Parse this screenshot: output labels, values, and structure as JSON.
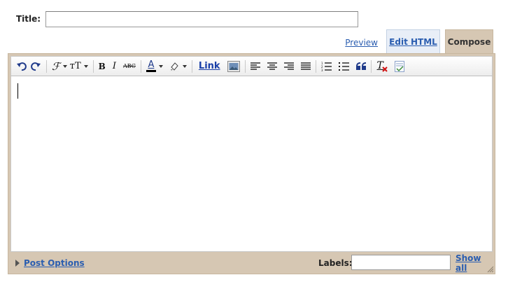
{
  "title_field": {
    "label": "Title:",
    "value": ""
  },
  "tabs": {
    "preview": "Preview",
    "edit_html": "Edit HTML",
    "compose": "Compose"
  },
  "toolbar": {
    "icons": [
      "undo-icon",
      "redo-icon",
      "font-icon",
      "font-size-icon",
      "bold-icon",
      "italic-icon",
      "strikethrough-icon",
      "text-color-icon",
      "highlight-icon",
      "image-icon",
      "align-left-icon",
      "align-center-icon",
      "align-right-icon",
      "justify-icon",
      "numbered-list-icon",
      "bullet-list-icon",
      "blockquote-icon",
      "remove-formatting-icon",
      "spellcheck-icon"
    ],
    "bold_glyph": "B",
    "italic_glyph": "I",
    "strike_glyph": "ABC",
    "font_glyph": "ℱ",
    "font_size_glyph": "тT",
    "text_color_glyph": "A",
    "link_label": "Link",
    "remove_format_glyph": "T"
  },
  "editor": {
    "content": ""
  },
  "footer": {
    "post_options": "Post Options",
    "labels_label": "Labels:",
    "labels_value": "",
    "show_all": "Show all"
  },
  "colors": {
    "frame": "#d6c7b3",
    "link": "#2a5db0",
    "edit_tab_bg": "#e8eef7"
  }
}
